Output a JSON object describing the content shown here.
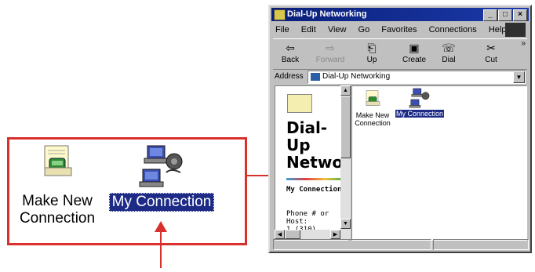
{
  "window": {
    "title": "Dial-Up Networking",
    "controls": [
      "_",
      "□",
      "×"
    ]
  },
  "menu": [
    "File",
    "Edit",
    "View",
    "Go",
    "Favorites",
    "Connections",
    "Help"
  ],
  "toolbar": [
    {
      "label": "Back",
      "icon": "back-arrow-icon",
      "enabled": true
    },
    {
      "label": "Forward",
      "icon": "forward-arrow-icon",
      "enabled": false
    },
    {
      "label": "Up",
      "icon": "up-folder-icon",
      "enabled": true
    },
    {
      "label": "Create",
      "icon": "create-icon",
      "enabled": true
    },
    {
      "label": "Dial",
      "icon": "dial-icon",
      "enabled": true
    },
    {
      "label": "Cut",
      "icon": "scissors-icon",
      "enabled": true
    }
  ],
  "address": {
    "label": "Address",
    "value": "Dial-Up Networking"
  },
  "left_pane": {
    "title": "Dial-Up Networl",
    "subtitle": "My Connection",
    "phone_label": "Phone # or Host:",
    "phone_value": "1 (310)"
  },
  "items": [
    {
      "label": "Make New Connection",
      "selected": false
    },
    {
      "label": "My Connection",
      "selected": true
    }
  ],
  "zoom": {
    "make_new_label": "Make New Connection",
    "my_connection_label": "My Connection"
  },
  "colors": {
    "callout_red": "#d9302c",
    "selection_blue": "#1d2a86",
    "titlebar_blue": "#0a1f7a",
    "window_gray": "#c0c0c0"
  }
}
